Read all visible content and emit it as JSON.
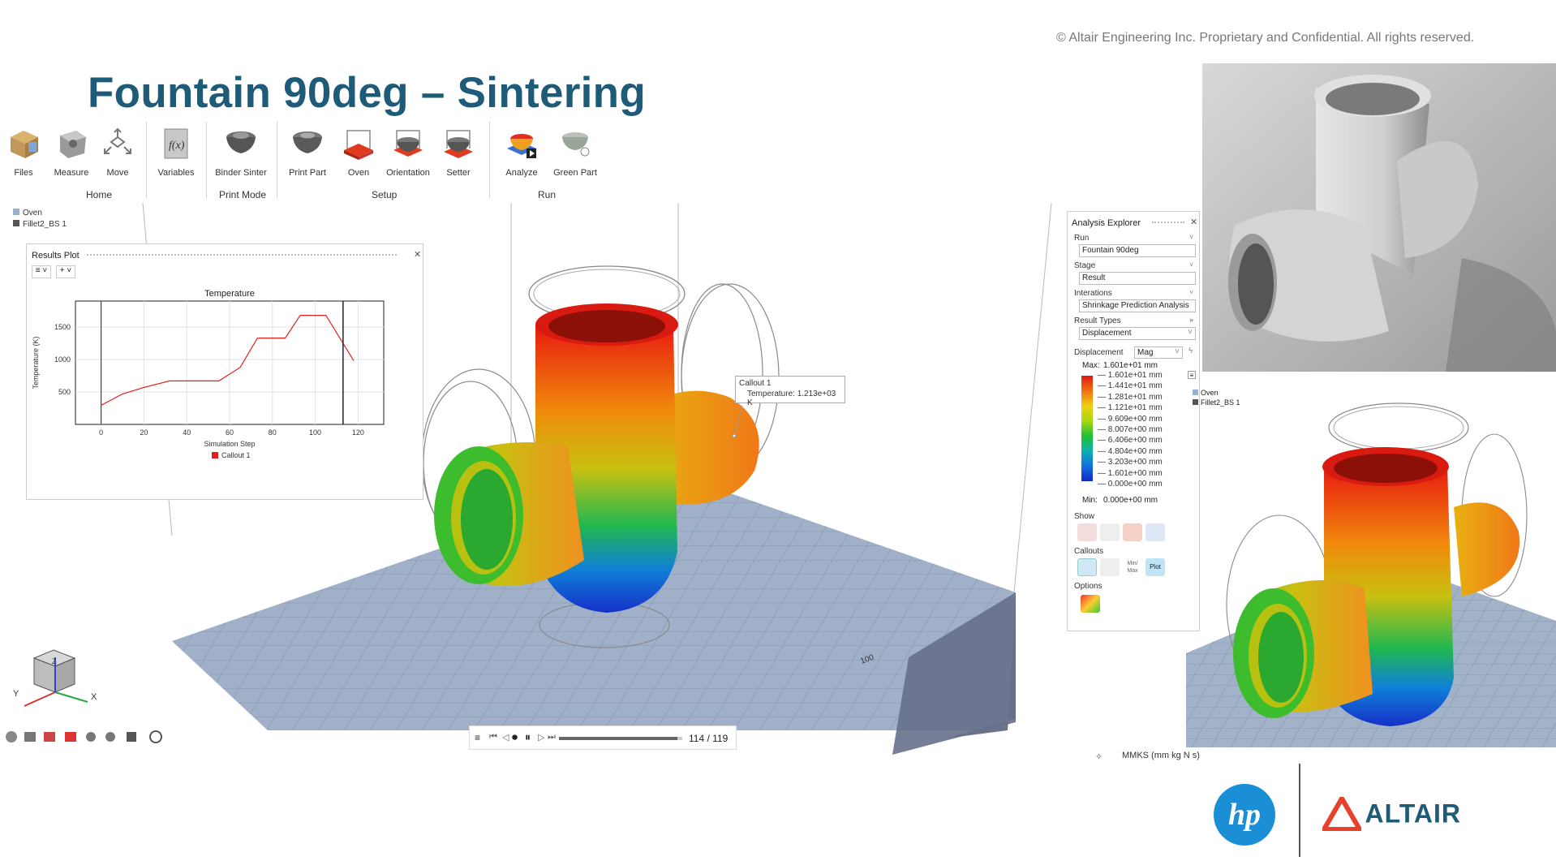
{
  "copyright": "© Altair Engineering Inc. Proprietary and Confidential. All rights reserved.",
  "title": "Fountain 90deg – Sintering",
  "ribbon": {
    "buttons": [
      {
        "label": "Files",
        "icon": "folder-icon"
      },
      {
        "label": "Measure",
        "icon": "measure-icon"
      },
      {
        "label": "Move",
        "icon": "move-icon"
      },
      {
        "label": "Variables",
        "icon": "function-icon"
      },
      {
        "label": "Binder Sinter",
        "icon": "binder-sinter-icon"
      },
      {
        "label": "Print Part",
        "icon": "print-part-icon"
      },
      {
        "label": "Oven",
        "icon": "oven-icon"
      },
      {
        "label": "Orientation",
        "icon": "orientation-icon"
      },
      {
        "label": "Setter",
        "icon": "setter-icon"
      },
      {
        "label": "Analyze",
        "icon": "analyze-icon"
      },
      {
        "label": "Green Part",
        "icon": "green-part-icon"
      }
    ],
    "groups": [
      "Home",
      "Print Mode",
      "Setup",
      "Run"
    ]
  },
  "model_tree": {
    "items": [
      "Oven",
      "Fillet2_BS 1"
    ]
  },
  "results_plot": {
    "title": "Results Plot",
    "chart_data": {
      "type": "line",
      "title": "Temperature",
      "xlabel": "Simulation Step",
      "ylabel": "Temperature (K)",
      "xlim": [
        -12,
        132
      ],
      "ylim": [
        0,
        1900
      ],
      "xticks": [
        0,
        20,
        40,
        60,
        80,
        100,
        120
      ],
      "yticks": [
        500,
        1000,
        1500
      ],
      "series": [
        {
          "name": "Callout 1",
          "color": "#e02020",
          "x": [
            0,
            10,
            20,
            32,
            40,
            55,
            65,
            73,
            86,
            93,
            105,
            118
          ],
          "y": [
            295,
            470,
            570,
            670,
            670,
            670,
            880,
            1330,
            1330,
            1680,
            1680,
            980
          ]
        }
      ],
      "marker_x": 113,
      "legend": "bottom"
    }
  },
  "callout": {
    "title": "Callout 1",
    "text": "Temperature: 1.213e+03 K"
  },
  "view_cube": {
    "y": "Y",
    "x": "X",
    "z": "Z"
  },
  "playback": {
    "counter": "114 / 119",
    "progress": 0.96
  },
  "analysis_explorer": {
    "title": "Analysis Explorer",
    "run_label": "Run",
    "run_value": "Fountain 90deg",
    "stage_label": "Stage",
    "stage_value": "Result",
    "iterations_label": "Interations",
    "iterations_value": "Shrinkage Prediction Analysis",
    "result_types_label": "Result Types",
    "result_types_value": "Displacement",
    "displacement_label": "Displacement",
    "displacement_mode": "Mag",
    "max_label": "Max:",
    "max_value": "1.601e+01 mm",
    "min_label": "Min:",
    "min_value": "0.000e+00 mm",
    "legend": [
      "1.601e+01 mm",
      "1.441e+01 mm",
      "1.281e+01 mm",
      "1.121e+01 mm",
      "9.609e+00 mm",
      "8.007e+00 mm",
      "6.406e+00 mm",
      "4.804e+00 mm",
      "3.203e+00 mm",
      "1.601e+00 mm",
      "0.000e+00 mm"
    ],
    "show_label": "Show",
    "callouts_label": "Callouts",
    "options_label": "Options",
    "minmax_label": "Min/ Max",
    "plot_label": "Plot"
  },
  "right_tree": {
    "items": [
      "Oven",
      "Fillet2_BS 1"
    ]
  },
  "units": "MMKS (mm kg N s)",
  "grid_label": "100",
  "logos": {
    "hp": "hp",
    "altair": "ALTAIR"
  }
}
